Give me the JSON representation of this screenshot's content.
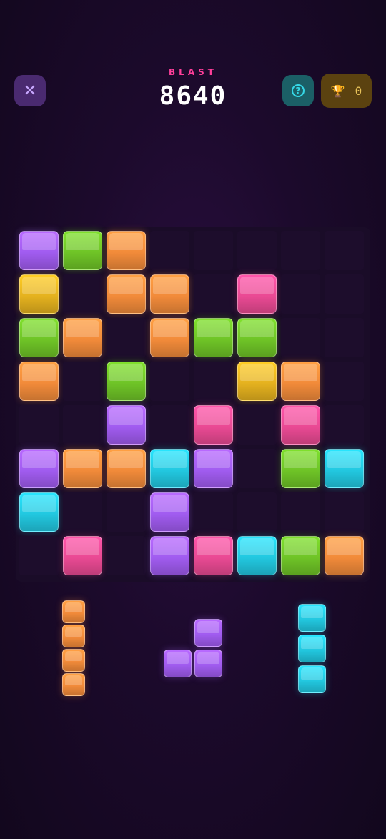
{
  "header": {
    "close_label": "✕",
    "title": "BLAST",
    "score": "8640",
    "help_label": "?",
    "trophy_icon": "🏆",
    "trophy_count": "0"
  },
  "colors": {
    "purple": "#a15cf0",
    "green": "#6fc427",
    "orange": "#f28b3a",
    "yellow": "#e5b21f",
    "pink": "#ea4a94",
    "cyan": "#22c8e0"
  },
  "board": {
    "size": 8,
    "rows": [
      [
        "purple",
        "green",
        "orange",
        null,
        null,
        null,
        null,
        null
      ],
      [
        "yellow",
        null,
        "orange",
        "orange",
        null,
        "pink",
        null,
        null
      ],
      [
        "green",
        "orange",
        null,
        "orange",
        "green",
        "green",
        null,
        null
      ],
      [
        "orange",
        null,
        "green",
        null,
        null,
        "yellow",
        "orange",
        null
      ],
      [
        null,
        null,
        "purple",
        null,
        "pink",
        null,
        "pink",
        null
      ],
      [
        "purple",
        "orange",
        "orange",
        "cyan",
        "purple",
        null,
        "green",
        "cyan"
      ],
      [
        "cyan",
        null,
        null,
        "purple",
        null,
        null,
        null,
        null
      ],
      [
        null,
        "pink",
        null,
        "purple",
        "pink",
        "cyan",
        "green",
        "orange"
      ]
    ]
  },
  "tray": [
    {
      "name": "orange-vertical-i4",
      "color": "orange",
      "cells": [
        [
          0,
          0
        ],
        [
          1,
          0
        ],
        [
          2,
          0
        ],
        [
          3,
          0
        ]
      ]
    },
    {
      "name": "purple-l3",
      "color": "purple",
      "cells": [
        [
          0,
          1
        ],
        [
          1,
          0
        ],
        [
          1,
          1
        ]
      ]
    },
    {
      "name": "cyan-vertical-i3",
      "color": "cyan",
      "cells": [
        [
          0,
          0
        ],
        [
          1,
          0
        ],
        [
          2,
          0
        ]
      ]
    }
  ]
}
